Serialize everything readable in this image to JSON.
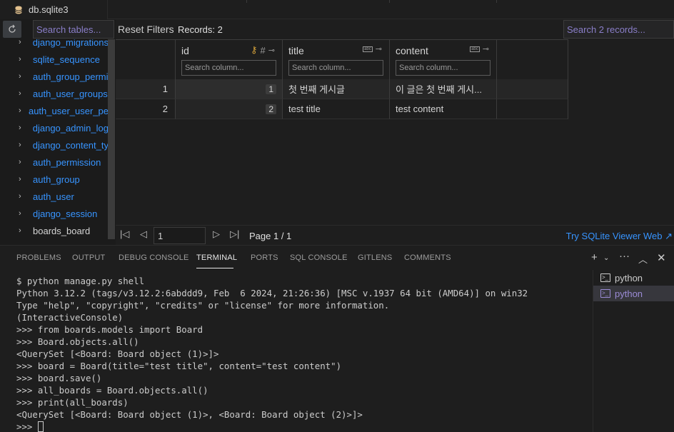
{
  "editor_tab": {
    "title": "db.sqlite3",
    "icon": "database-icon"
  },
  "sidebar": {
    "search_placeholder": "Search tables...",
    "tables": [
      {
        "name": "django_migrations",
        "highlighted": true
      },
      {
        "name": "sqlite_sequence",
        "highlighted": true
      },
      {
        "name": "auth_group_permi",
        "highlighted": true
      },
      {
        "name": "auth_user_groups",
        "highlighted": true
      },
      {
        "name": "auth_user_user_pe",
        "highlighted": true
      },
      {
        "name": "django_admin_log",
        "highlighted": true
      },
      {
        "name": "django_content_ty",
        "highlighted": true
      },
      {
        "name": "auth_permission",
        "highlighted": true
      },
      {
        "name": "auth_group",
        "highlighted": true
      },
      {
        "name": "auth_user",
        "highlighted": true
      },
      {
        "name": "django_session",
        "highlighted": true
      },
      {
        "name": "boards_board",
        "highlighted": false
      }
    ]
  },
  "grid": {
    "reset_label": "Reset Filters",
    "records_label": "Records: 2",
    "search_placeholder": "Search 2 records...",
    "columns": [
      {
        "name": "id",
        "search_placeholder": "Search column..."
      },
      {
        "name": "title",
        "search_placeholder": "Search column..."
      },
      {
        "name": "content",
        "search_placeholder": "Search column..."
      }
    ],
    "rows": [
      {
        "rownum": "1",
        "id": "1",
        "title": "첫 번째 게시글",
        "content": "이 글은 첫 번째 게시..."
      },
      {
        "rownum": "2",
        "id": "2",
        "title": "test title",
        "content": "test content"
      }
    ],
    "pager": {
      "page_value": "1",
      "page_info": "Page 1 / 1",
      "try_link": "Try SQLite Viewer Web ↗"
    }
  },
  "panel": {
    "tabs": [
      "PROBLEMS",
      "OUTPUT",
      "DEBUG CONSOLE",
      "TERMINAL",
      "PORTS",
      "SQL CONSOLE",
      "GITLENS",
      "COMMENTS"
    ],
    "active_tab": "TERMINAL"
  },
  "terminal": {
    "lines": [
      "$ python manage.py shell",
      "Python 3.12.2 (tags/v3.12.2:6abddd9, Feb  6 2024, 21:26:36) [MSC v.1937 64 bit (AMD64)] on win32",
      "Type \"help\", \"copyright\", \"credits\" or \"license\" for more information.",
      "(InteractiveConsole)",
      ">>> from boards.models import Board",
      ">>> Board.objects.all()",
      "<QuerySet [<Board: Board object (1)>]>",
      ">>> board = Board(title=\"test title\", content=\"test content\")",
      ">>> board.save()",
      ">>> all_boards = Board.objects.all()",
      ">>> print(all_boards)",
      "<QuerySet [<Board: Board object (1)>, <Board: Board object (2)>]>"
    ],
    "prompt": ">>> ",
    "sessions": [
      "python",
      "python"
    ]
  },
  "colors": {
    "accent": "#3794ff",
    "placeholder": "#8a7ec9",
    "selected_session": "#9b8bd6"
  }
}
